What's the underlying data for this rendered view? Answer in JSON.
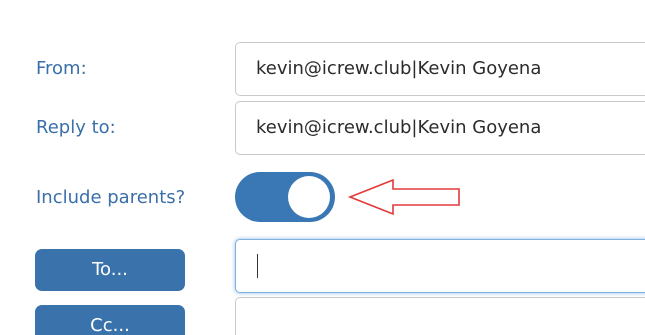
{
  "form": {
    "from": {
      "label": "From:",
      "value": "kevin@icrew.club|Kevin Goyena"
    },
    "reply_to": {
      "label": "Reply to:",
      "value": "kevin@icrew.club|Kevin Goyena"
    },
    "include_parents": {
      "label": "Include parents?",
      "state": "on"
    },
    "to": {
      "button_label": "To...",
      "value": ""
    },
    "cc": {
      "button_label": "Cc..."
    }
  },
  "icons": {
    "annotation": "red-outline-arrow-icon"
  },
  "colors": {
    "label_text": "#3a6fa8",
    "toggle_on": "#3a78b5",
    "button_bg": "#3a72ac",
    "focus_border": "#7fb0de",
    "annotation_arrow": "#e23a3a"
  }
}
